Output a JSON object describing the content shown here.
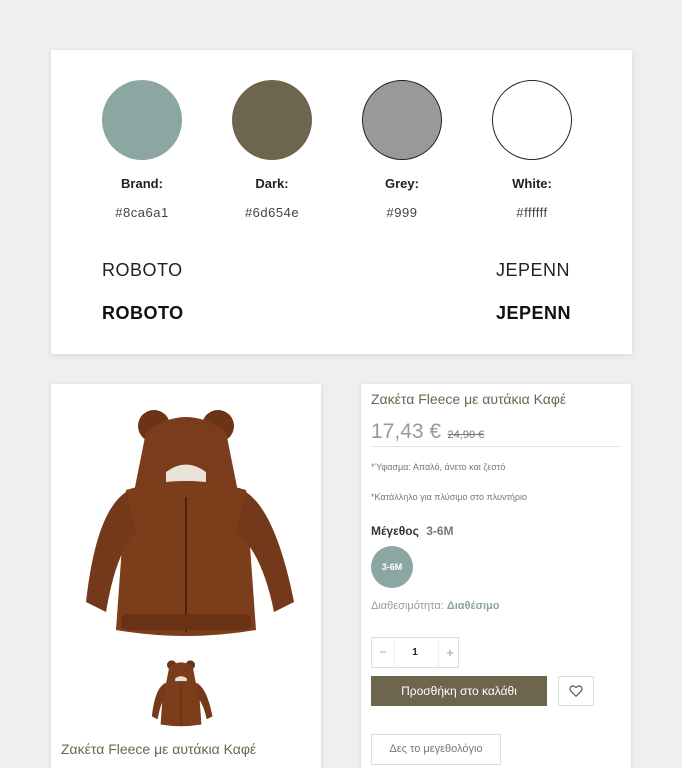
{
  "palette": {
    "swatches": [
      {
        "label": "Brand:",
        "hex": "#8ca6a1",
        "color": "#8ca6a1"
      },
      {
        "label": "Dark:",
        "hex": "#6d654e",
        "color": "#6d654e"
      },
      {
        "label": "Grey:",
        "hex": "#999",
        "color": "#999999"
      },
      {
        "label": "White:",
        "hex": "#ffffff",
        "color": "#ffffff"
      }
    ],
    "fonts": {
      "roboto_light": "ROBOTO",
      "roboto_bold": "ROBOTO",
      "jepenn_light": "JEPENN",
      "jepenn_bold": "JEPENN"
    }
  },
  "product": {
    "title": "Ζακέτα Fleece με αυτάκια Καφέ",
    "price": "17,43 €",
    "old_price": "24,90 €",
    "feature_1": "*Ύφασμα: Απαλό, άνετο και ζεστό",
    "feature_2": "*Κατάλληλο για πλύσιμο στο πλυντήριο",
    "size_label": "Μέγεθος",
    "size_value": "3-6M",
    "size_option": "3-6M",
    "availability_label": "Διαθεσιμότητα:",
    "availability_value": "Διαθέσιμο",
    "qty_minus": "−",
    "qty_value": "1",
    "qty_plus": "+",
    "add_to_cart": "Προσθήκη στο καλάθι",
    "size_guide": "Δες το μεγεθολόγιο",
    "image_caption": "Ζακέτα Fleece με αυτάκια Καφέ"
  },
  "icons": {
    "wishlist": "heart-icon",
    "jacket": "jacket-image"
  },
  "colors": {
    "brand": "#8ca6a1",
    "dark": "#6d654e",
    "grey": "#999999",
    "white": "#ffffff"
  }
}
